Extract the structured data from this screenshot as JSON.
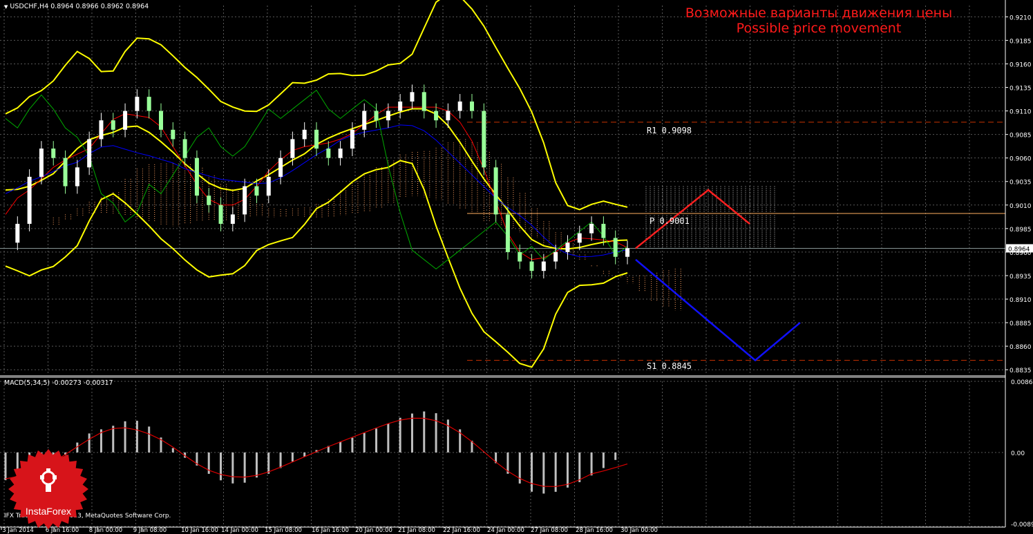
{
  "header": {
    "symbol": "USDCHF,H4",
    "ohlc": "0.8964 0.8966 0.8962 0.8964"
  },
  "annotation": {
    "line1": "Возможные варианты движения цены",
    "line2": "Possible price movement"
  },
  "levels": {
    "r1_label": "R1  0.9098",
    "p_label": "P  0.9001",
    "s1_label": "S1  0.8845",
    "current_price": "0.8964"
  },
  "price_axis_labels": [
    "0.9210",
    "0.9185",
    "0.9160",
    "0.9135",
    "0.9110",
    "0.9085",
    "0.9060",
    "0.9035",
    "0.9010",
    "0.8985",
    "0.8960",
    "0.8935",
    "0.8910",
    "0.8885",
    "0.8860",
    "0.8835"
  ],
  "macd": {
    "header": "MACD(5,34,5) -0.00273 -0.00317",
    "axis_labels": [
      "0.00865",
      "0.00",
      "-0.00899"
    ]
  },
  "time_axis_labels": [
    "3 Jan 2014",
    "6 Jan 16:00",
    "8 Jan 00:00",
    "9 Jan 08:00",
    "10 Jan 16:00",
    "14 Jan 00:00",
    "15 Jan 08:00",
    "16 Jan 16:00",
    "20 Jan 00:00",
    "21 Jan 08:00",
    "22 Jan 16:00",
    "24 Jan 00:00",
    "27 Jan 08:00",
    "28 Jan 16:00",
    "30 Jan 00:00"
  ],
  "copyright": "IFX Trader, © 2001-2013, MetaQuotes Software Corp.",
  "logo_text": "InstaForex",
  "colors": {
    "background": "#000000",
    "bollinger": "#ffff00",
    "ichimoku_tenkan": "#ff0000",
    "ichimoku_kijun": "#0000ff",
    "chikou": "#00aa00",
    "cloud": "#ffa060",
    "forecast_up": "#ff2020",
    "forecast_down": "#1010ff",
    "candle_bull": "#ffffff",
    "candle_bear": "#99ff99",
    "level_line": "#cc3300",
    "macd_hist": "#c0c0c0",
    "macd_signal": "#dd0000"
  },
  "chart_data": {
    "type": "candlestick",
    "symbol": "USDCHF",
    "timeframe": "H4",
    "ylim": [
      0.883,
      0.9222
    ],
    "x_range": [
      "3 Jan 2014",
      "30 Jan 00:00"
    ],
    "close_approx": [
      0.897,
      0.899,
      0.904,
      0.907,
      0.906,
      0.903,
      0.905,
      0.908,
      0.91,
      0.909,
      0.911,
      0.9125,
      0.911,
      0.909,
      0.908,
      0.906,
      0.902,
      0.901,
      0.899,
      0.9,
      0.903,
      0.902,
      0.904,
      0.906,
      0.908,
      0.909,
      0.907,
      0.906,
      0.907,
      0.909,
      0.911,
      0.91,
      0.911,
      0.912,
      0.913,
      0.911,
      0.91,
      0.911,
      0.912,
      0.911,
      0.905,
      0.9,
      0.896,
      0.895,
      0.894,
      0.895,
      0.896,
      0.897,
      0.898,
      0.899,
      0.8975,
      0.8955,
      0.8964
    ],
    "pivot_levels": {
      "R1": 0.9098,
      "P": 0.9001,
      "S1": 0.8845
    },
    "current_price": 0.8964,
    "forecast_scenarios": [
      {
        "name": "up",
        "points": [
          0.8964,
          0.9026,
          0.899
        ]
      },
      {
        "name": "down",
        "points": [
          0.8952,
          0.8845,
          0.8885
        ]
      }
    ],
    "macd": {
      "params": "5,34,5",
      "main": -0.00273,
      "signal": -0.00317,
      "ylim": [
        -0.00899,
        0.00865
      ]
    }
  }
}
